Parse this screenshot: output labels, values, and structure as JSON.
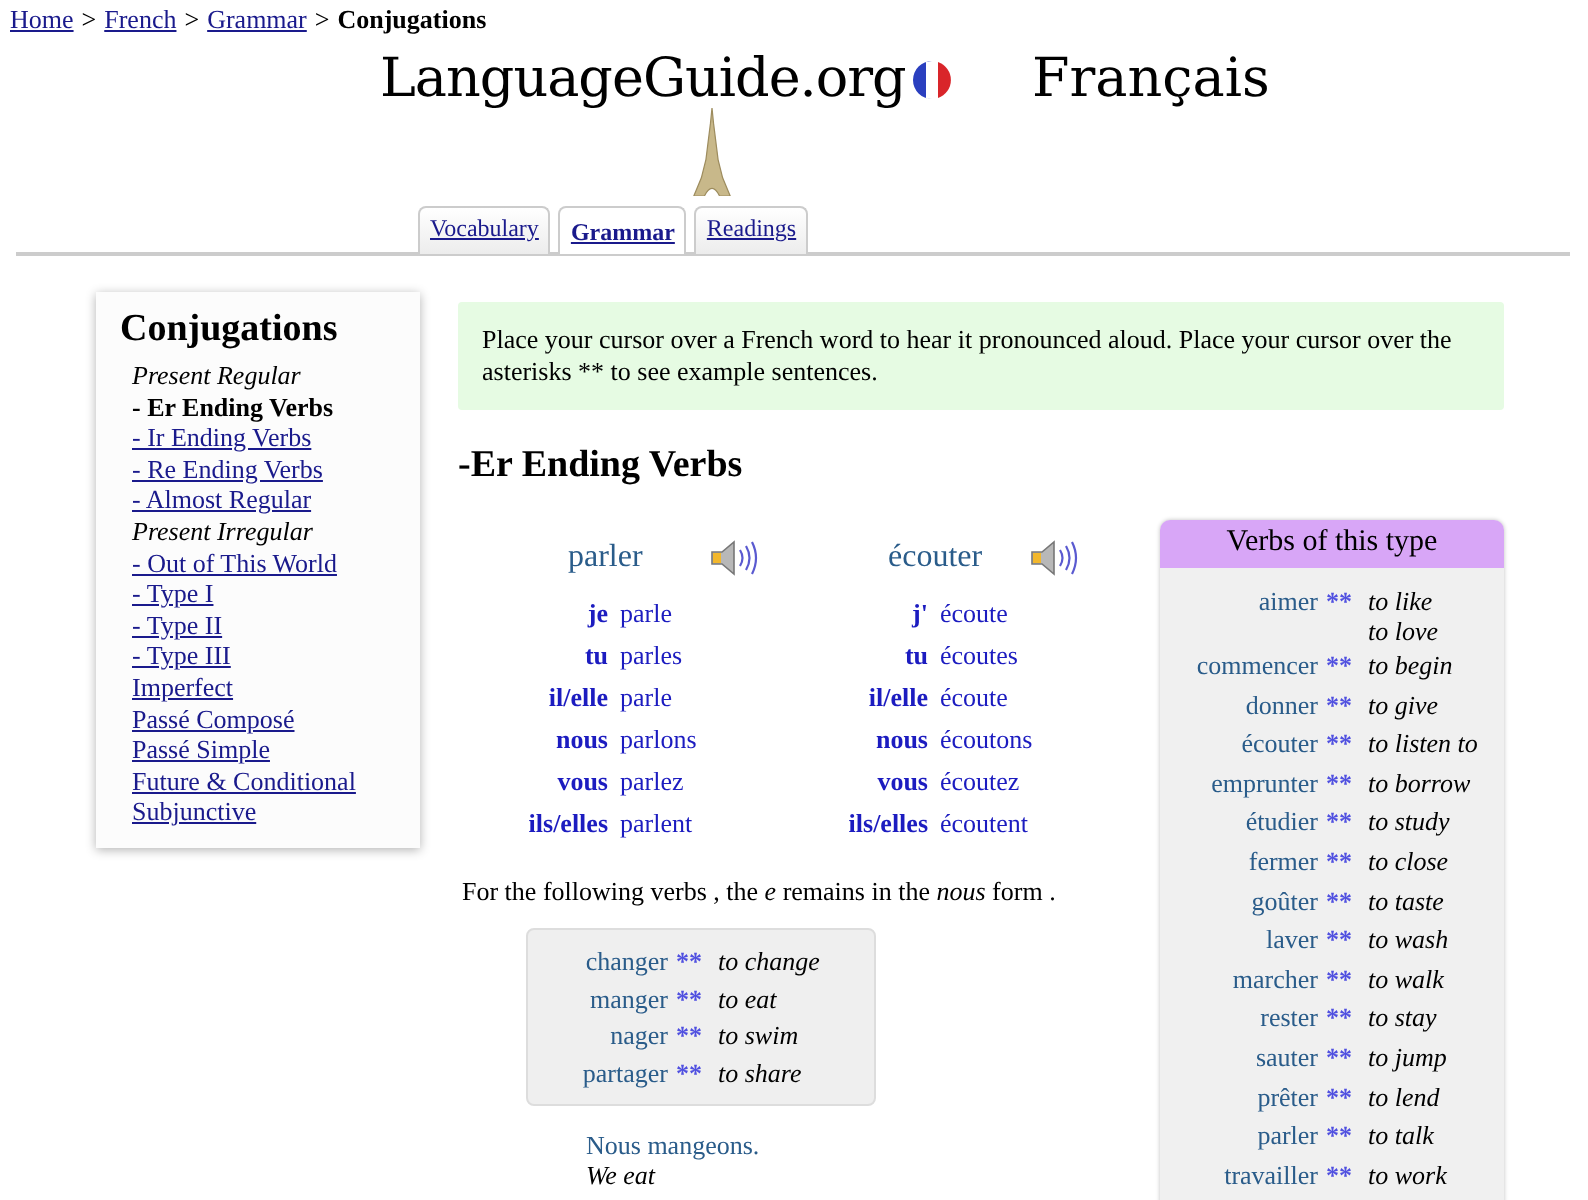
{
  "breadcrumb": {
    "links": [
      "Home",
      "French",
      "Grammar"
    ],
    "separator": ">",
    "current": "Conjugations"
  },
  "logo": {
    "text": "LanguageGuide.org",
    "language": "Français"
  },
  "tabs": [
    {
      "label": "Vocabulary",
      "selected": false
    },
    {
      "label": "Grammar",
      "selected": true
    },
    {
      "label": "Readings",
      "selected": false
    }
  ],
  "sidebar": {
    "title": "Conjugations",
    "items": [
      {
        "label": "Present Regular",
        "kind": "heading"
      },
      {
        "label": "- Er Ending Verbs",
        "kind": "link",
        "selected": true
      },
      {
        "label": "- Ir Ending Verbs",
        "kind": "link",
        "selected": false
      },
      {
        "label": "- Re Ending Verbs",
        "kind": "link",
        "selected": false
      },
      {
        "label": "- Almost Regular",
        "kind": "link",
        "selected": false
      },
      {
        "label": "Present Irregular",
        "kind": "heading"
      },
      {
        "label": "- Out of This World",
        "kind": "link",
        "selected": false
      },
      {
        "label": "- Type I",
        "kind": "link",
        "selected": false
      },
      {
        "label": "- Type II",
        "kind": "link",
        "selected": false
      },
      {
        "label": "- Type III",
        "kind": "link",
        "selected": false
      },
      {
        "label": "Imperfect",
        "kind": "link",
        "selected": false
      },
      {
        "label": "Passé Composé",
        "kind": "link",
        "selected": false
      },
      {
        "label": "Passé Simple",
        "kind": "link",
        "selected": false
      },
      {
        "label": "Future & Conditional",
        "kind": "link",
        "selected": false
      },
      {
        "label": "Subjunctive",
        "kind": "link",
        "selected": false
      }
    ]
  },
  "notice": "Place your cursor over a French word to hear it pronounced aloud. Place your cursor over the asterisks ** to see example sentences.",
  "heading": "-Er Ending Verbs",
  "conjugations": [
    {
      "verb": "parler",
      "rows": [
        [
          "je",
          "parle"
        ],
        [
          "tu",
          "parles"
        ],
        [
          "il/elle",
          "parle"
        ],
        [
          "nous",
          "parlons"
        ],
        [
          "vous",
          "parlez"
        ],
        [
          "ils/elles",
          "parlent"
        ]
      ]
    },
    {
      "verb": "écouter",
      "rows": [
        [
          "j'",
          "écoute"
        ],
        [
          "tu",
          "écoutes"
        ],
        [
          "il/elle",
          "écoute"
        ],
        [
          "nous",
          "écoutons"
        ],
        [
          "vous",
          "écoutez"
        ],
        [
          "ils/elles",
          "écoutent"
        ]
      ]
    }
  ],
  "note": "For the following verbs , the *e* remains in the *nous* form .",
  "exceptions": [
    {
      "verb": "changer",
      "mark": "**",
      "meaning": [
        "to change"
      ]
    },
    {
      "verb": "manger",
      "mark": "**",
      "meaning": [
        "to eat"
      ]
    },
    {
      "verb": "nager",
      "mark": "**",
      "meaning": [
        "to swim"
      ]
    },
    {
      "verb": "partager",
      "mark": "**",
      "meaning": [
        "to share"
      ]
    }
  ],
  "example": {
    "sentence": "Nous mangeons.",
    "translation": "We eat"
  },
  "verbs_box": {
    "title": "Verbs of this type",
    "verbs": [
      {
        "verb": "aimer",
        "mark": "**",
        "meaning": [
          "to like",
          "to love"
        ]
      },
      {
        "verb": "commencer",
        "mark": "**",
        "meaning": [
          "to begin"
        ]
      },
      {
        "verb": "donner",
        "mark": "**",
        "meaning": [
          "to give"
        ]
      },
      {
        "verb": "écouter",
        "mark": "**",
        "meaning": [
          "to listen to"
        ]
      },
      {
        "verb": "emprunter",
        "mark": "**",
        "meaning": [
          "to borrow"
        ]
      },
      {
        "verb": "étudier",
        "mark": "**",
        "meaning": [
          "to study"
        ]
      },
      {
        "verb": "fermer",
        "mark": "**",
        "meaning": [
          "to close"
        ]
      },
      {
        "verb": "goûter",
        "mark": "**",
        "meaning": [
          "to taste"
        ]
      },
      {
        "verb": "laver",
        "mark": "**",
        "meaning": [
          "to wash"
        ]
      },
      {
        "verb": "marcher",
        "mark": "**",
        "meaning": [
          "to walk"
        ]
      },
      {
        "verb": "rester",
        "mark": "**",
        "meaning": [
          "to stay"
        ]
      },
      {
        "verb": "sauter",
        "mark": "**",
        "meaning": [
          "to jump"
        ]
      },
      {
        "verb": "prêter",
        "mark": "**",
        "meaning": [
          "to lend"
        ]
      },
      {
        "verb": "parler",
        "mark": "**",
        "meaning": [
          "to talk"
        ]
      },
      {
        "verb": "travailler",
        "mark": "**",
        "meaning": [
          "to work"
        ]
      }
    ]
  }
}
